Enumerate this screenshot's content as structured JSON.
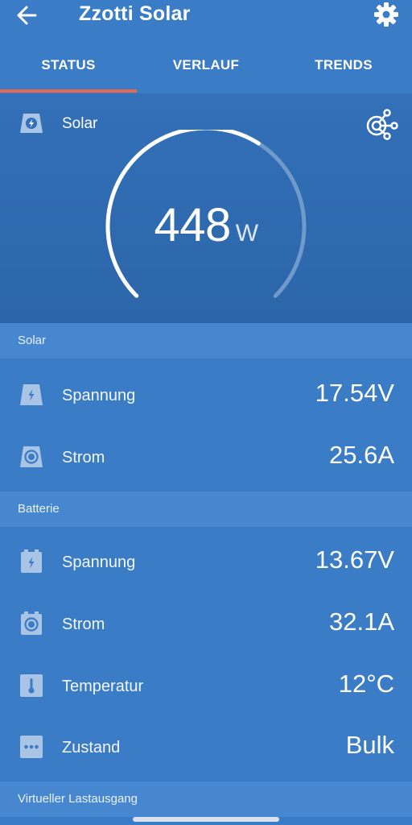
{
  "header": {
    "title": "Zzotti Solar",
    "back_icon": "arrow-left-icon",
    "settings_icon": "gear-icon"
  },
  "tabs": [
    {
      "label": "STATUS",
      "active": true
    },
    {
      "label": "VERLAUF",
      "active": false
    },
    {
      "label": "TRENDS",
      "active": false
    }
  ],
  "hero": {
    "label": "Solar",
    "power_value": "448",
    "power_unit": "W",
    "gauge_fraction": 0.62,
    "icons": {
      "source": "solar-panel-icon",
      "network": "network-icon"
    }
  },
  "sections": {
    "solar": {
      "header": "Solar",
      "rows": [
        {
          "label": "Spannung",
          "value": "17.54V",
          "icon": "solar-voltage-icon"
        },
        {
          "label": "Strom",
          "value": "25.6A",
          "icon": "solar-current-icon"
        }
      ]
    },
    "batterie": {
      "header": "Batterie",
      "rows": [
        {
          "label": "Spannung",
          "value": "13.67V",
          "icon": "battery-voltage-icon"
        },
        {
          "label": "Strom",
          "value": "32.1A",
          "icon": "battery-current-icon"
        },
        {
          "label": "Temperatur",
          "value": "12°C",
          "icon": "thermometer-icon"
        },
        {
          "label": "Zustand",
          "value": "Bulk",
          "icon": "more-icon"
        }
      ]
    },
    "last": {
      "header": "Virtueller Lastausgang"
    }
  },
  "colors": {
    "background": "#3a7cc6",
    "hero": "#2c66a9",
    "section_header": "#4687d0",
    "tab_indicator": "#e8674f"
  }
}
